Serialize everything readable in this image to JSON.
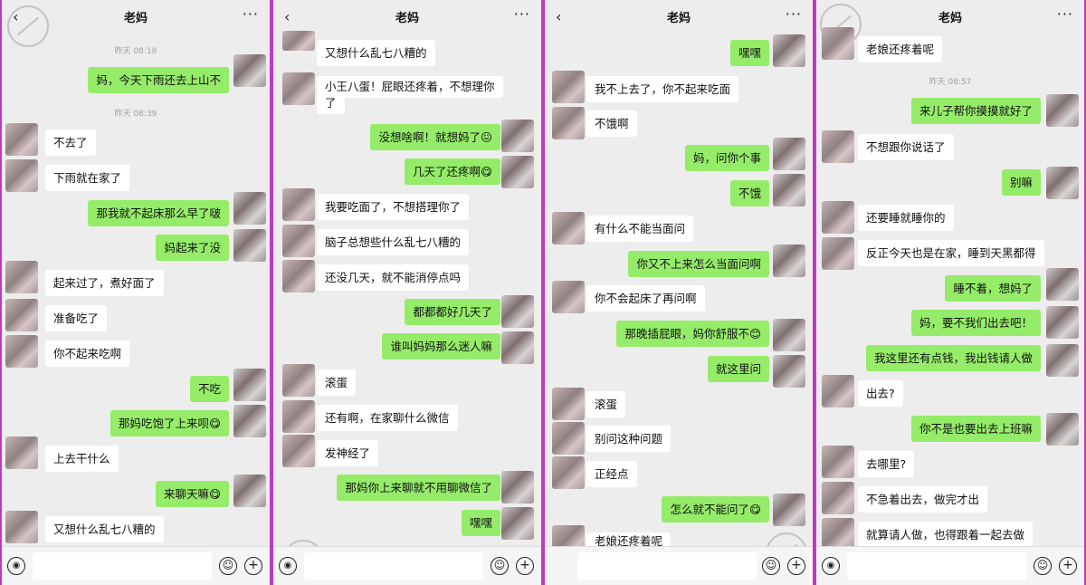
{
  "contact_name": "老妈",
  "back_glyph": "‹",
  "more_glyph": "···",
  "icons": {
    "voice": "voice-icon",
    "emoji": "emoji-icon",
    "plus": "plus-icon"
  },
  "colors": {
    "outgoing_bubble": "#95ec69",
    "incoming_bubble": "#ffffff",
    "background": "#ededed",
    "divider": "#c03ac0"
  },
  "panels": [
    {
      "timestamps": [
        "昨天 08:18",
        "昨天 08:39"
      ],
      "messages": [
        {
          "side": "out",
          "text": "妈，今天下雨还去上山不"
        },
        {
          "side": "in",
          "text": "不去了"
        },
        {
          "side": "in",
          "text": "下雨就在家了"
        },
        {
          "side": "out",
          "text": "那我就不起床那么早了啵"
        },
        {
          "side": "out",
          "text": "妈起来了没"
        },
        {
          "side": "in",
          "text": "起来过了，煮好面了"
        },
        {
          "side": "in",
          "text": "准备吃了"
        },
        {
          "side": "in",
          "text": "你不起来吃啊"
        },
        {
          "side": "out",
          "text": "不吃"
        },
        {
          "side": "out",
          "text": "那妈吃饱了上来呗😋"
        },
        {
          "side": "in",
          "text": "上去干什么"
        },
        {
          "side": "out",
          "text": "来聊天嘛😋"
        },
        {
          "side": "in",
          "text": "又想什么乱七八糟的"
        }
      ]
    },
    {
      "timestamps": [],
      "messages": [
        {
          "side": "in",
          "text": "又想什么乱七八糟的"
        },
        {
          "side": "in",
          "text": "小王八蛋！屁眼还疼着，不想理你"
        },
        {
          "side": "in",
          "text": "了"
        },
        {
          "side": "out",
          "text": "没想啥啊！就想妈了😖"
        },
        {
          "side": "out",
          "text": "几天了还疼啊😋"
        },
        {
          "side": "in",
          "text": "我要吃面了，不想搭理你了"
        },
        {
          "side": "in",
          "text": "脑子总想些什么乱七八糟的"
        },
        {
          "side": "in",
          "text": "还没几天，就不能消停点吗"
        },
        {
          "side": "out",
          "text": "都都都好几天了"
        },
        {
          "side": "out",
          "text": "谁叫妈妈那么迷人嘛"
        },
        {
          "side": "in",
          "text": "滚蛋"
        },
        {
          "side": "in",
          "text": "还有啊，在家聊什么微信"
        },
        {
          "side": "in",
          "text": "发神经了"
        },
        {
          "side": "out",
          "text": "那妈你上来聊就不用聊微信了"
        },
        {
          "side": "out",
          "text": "嘿嘿"
        }
      ]
    },
    {
      "timestamps": [],
      "messages": [
        {
          "side": "out",
          "text": "嘿嘿"
        },
        {
          "side": "in",
          "text": "我不上去了，你不起来吃面"
        },
        {
          "side": "in",
          "text": "不饿啊"
        },
        {
          "side": "out",
          "text": "妈，问你个事"
        },
        {
          "side": "out",
          "text": "不饿"
        },
        {
          "side": "in",
          "text": "有什么不能当面问"
        },
        {
          "side": "out",
          "text": "你又不上来怎么当面问啊"
        },
        {
          "side": "in",
          "text": "你不会起床了再问啊"
        },
        {
          "side": "out",
          "text": "那晚插屁眼，妈你舒服不😊"
        },
        {
          "side": "out",
          "text": "就这里问"
        },
        {
          "side": "in",
          "text": "滚蛋"
        },
        {
          "side": "in",
          "text": "别问这种问题"
        },
        {
          "side": "in",
          "text": "正经点"
        },
        {
          "side": "out",
          "text": "怎么就不能问了😋"
        },
        {
          "side": "in",
          "text": "老娘还疼着呢"
        }
      ]
    },
    {
      "timestamps": [
        "昨天 08:57"
      ],
      "messages": [
        {
          "side": "in",
          "text": "老娘还疼着呢"
        },
        {
          "side": "out",
          "text": "来儿子帮你摸摸就好了"
        },
        {
          "side": "in",
          "text": "不想跟你说话了"
        },
        {
          "side": "out",
          "text": "别嘛"
        },
        {
          "side": "in",
          "text": "还要睡就睡你的"
        },
        {
          "side": "in",
          "text": "反正今天也是在家，睡到天黑都得"
        },
        {
          "side": "out",
          "text": "睡不着，想妈了"
        },
        {
          "side": "out",
          "text": "妈，要不我们出去吧！"
        },
        {
          "side": "out",
          "text": "我这里还有点钱，我出钱请人做"
        },
        {
          "side": "in",
          "text": "出去?"
        },
        {
          "side": "out",
          "text": "你不是也要出去上班嘛"
        },
        {
          "side": "in",
          "text": "去哪里?"
        },
        {
          "side": "in",
          "text": "不急着出去，做完才出"
        },
        {
          "side": "in",
          "text": "就算请人做，也得跟着一起去做"
        }
      ]
    }
  ]
}
